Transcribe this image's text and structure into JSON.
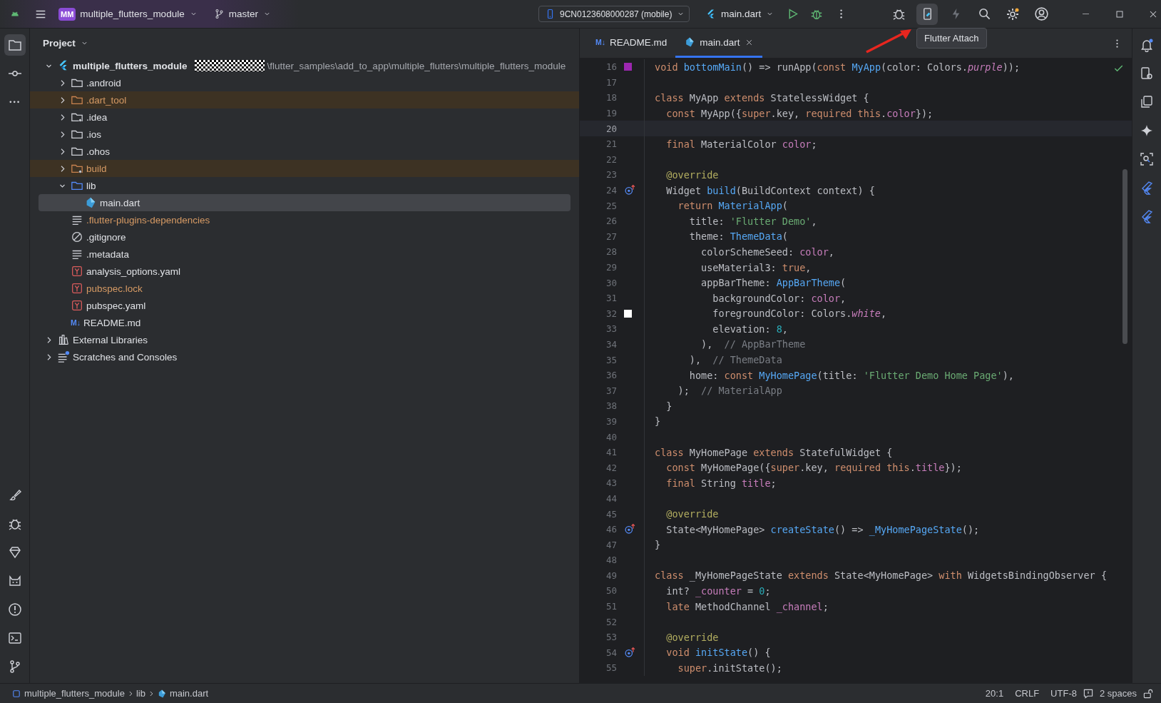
{
  "title_bar": {
    "project_badge": "MM",
    "project": "multiple_flutters_module",
    "branch": "master",
    "device": "9CN0123608000287 (mobile)",
    "run_config": "main.dart",
    "tooltip": "Flutter Attach"
  },
  "project_panel": {
    "title": "Project",
    "tree": [
      {
        "label": "multiple_flutters_module",
        "kind": "flutter",
        "expanded": true,
        "selected": false,
        "excluded": false,
        "ignored": false,
        "redacted": true,
        "path": "\\flutter_samples\\add_to_app\\multiple_flutters\\multiple_flutters_module",
        "children": [
          {
            "label": ".android",
            "kind": "folder",
            "expanded": false,
            "selected": false,
            "excluded": false,
            "ignored": false
          },
          {
            "label": ".dart_tool",
            "kind": "folder",
            "expanded": false,
            "selected": false,
            "excluded": true,
            "ignored": true
          },
          {
            "label": ".idea",
            "kind": "folder-config",
            "expanded": false,
            "selected": false,
            "excluded": false,
            "ignored": false
          },
          {
            "label": ".ios",
            "kind": "folder",
            "expanded": false,
            "selected": false,
            "excluded": false,
            "ignored": false
          },
          {
            "label": ".ohos",
            "kind": "folder",
            "expanded": false,
            "selected": false,
            "excluded": false,
            "ignored": false
          },
          {
            "label": "build",
            "kind": "folder-config",
            "expanded": false,
            "selected": false,
            "excluded": true,
            "ignored": true
          },
          {
            "label": "lib",
            "kind": "folder-source",
            "expanded": true,
            "selected": false,
            "excluded": false,
            "ignored": false,
            "children": [
              {
                "label": "main.dart",
                "kind": "dart",
                "selected": true,
                "excluded": false,
                "ignored": false
              }
            ]
          },
          {
            "label": ".flutter-plugins-dependencies",
            "kind": "text",
            "selected": false,
            "excluded": false,
            "ignored": true
          },
          {
            "label": ".gitignore",
            "kind": "ignore",
            "selected": false,
            "excluded": false,
            "ignored": false
          },
          {
            "label": ".metadata",
            "kind": "text",
            "selected": false,
            "excluded": false,
            "ignored": false
          },
          {
            "label": "analysis_options.yaml",
            "kind": "yaml",
            "selected": false,
            "excluded": false,
            "ignored": false
          },
          {
            "label": "pubspec.lock",
            "kind": "yaml",
            "selected": false,
            "excluded": false,
            "ignored": true
          },
          {
            "label": "pubspec.yaml",
            "kind": "yaml",
            "selected": false,
            "excluded": false,
            "ignored": false
          },
          {
            "label": "README.md",
            "kind": "markdown",
            "icon_text": "M↓",
            "selected": false,
            "excluded": false,
            "ignored": false
          }
        ]
      },
      {
        "label": "External Libraries",
        "kind": "library",
        "expanded": false,
        "selected": false,
        "excluded": false,
        "ignored": false
      },
      {
        "label": "Scratches and Consoles",
        "kind": "scratches",
        "expanded": false,
        "selected": false,
        "excluded": false,
        "ignored": false
      }
    ]
  },
  "editor": {
    "tabs": [
      {
        "label": "README.md",
        "kind": "markdown",
        "icon_text": "M↓",
        "selected": false
      },
      {
        "label": "main.dart",
        "kind": "dart",
        "selected": true
      }
    ],
    "lines": [
      {
        "number": "16",
        "current": false,
        "gutter": {
          "kind": "swatch",
          "color": "#9c27b0"
        },
        "tokens": [
          {
            "kind": "kw",
            "text": "void "
          },
          {
            "kind": "fn",
            "text": "bottomMain"
          },
          {
            "kind": "plain",
            "text": "() => runApp("
          },
          {
            "kind": "kw",
            "text": "const "
          },
          {
            "kind": "fn",
            "text": "MyApp"
          },
          {
            "kind": "plain",
            "text": "(color: Colors."
          },
          {
            "kind": "static",
            "text": "purple"
          },
          {
            "kind": "plain",
            "text": "));"
          }
        ]
      },
      {
        "number": "17",
        "current": false
      },
      {
        "number": "18",
        "current": false,
        "tokens": [
          {
            "kind": "kw",
            "text": "class"
          },
          {
            "kind": "plain",
            "text": " MyApp "
          },
          {
            "kind": "kw",
            "text": "extends"
          },
          {
            "kind": "plain",
            "text": " StatelessWidget {"
          }
        ]
      },
      {
        "number": "19",
        "current": false,
        "tokens": [
          {
            "kind": "kw",
            "text": "  const"
          },
          {
            "kind": "plain",
            "text": " MyApp({"
          },
          {
            "kind": "kw",
            "text": "super"
          },
          {
            "kind": "plain",
            "text": ".key, "
          },
          {
            "kind": "kw",
            "text": "required this"
          },
          {
            "kind": "plain",
            "text": "."
          },
          {
            "kind": "field",
            "text": "color"
          },
          {
            "kind": "plain",
            "text": "});"
          }
        ]
      },
      {
        "number": "20",
        "current": true
      },
      {
        "number": "21",
        "current": false,
        "tokens": [
          {
            "kind": "kw",
            "text": "  final"
          },
          {
            "kind": "plain",
            "text": " MaterialColor "
          },
          {
            "kind": "field",
            "text": "color"
          },
          {
            "kind": "plain",
            "text": ";"
          }
        ]
      },
      {
        "number": "22",
        "current": false
      },
      {
        "number": "23",
        "current": false,
        "tokens": [
          {
            "kind": "ann",
            "text": "  @override"
          }
        ]
      },
      {
        "number": "24",
        "current": false,
        "gutter": {
          "kind": "override"
        },
        "tokens": [
          {
            "kind": "plain",
            "text": "  Widget "
          },
          {
            "kind": "fn",
            "text": "build"
          },
          {
            "kind": "plain",
            "text": "(BuildContext context) {"
          }
        ]
      },
      {
        "number": "25",
        "current": false,
        "tokens": [
          {
            "kind": "kw",
            "text": "    return "
          },
          {
            "kind": "fn",
            "text": "MaterialApp"
          },
          {
            "kind": "plain",
            "text": "("
          }
        ]
      },
      {
        "number": "26",
        "current": false,
        "tokens": [
          {
            "kind": "plain",
            "text": "      title: "
          },
          {
            "kind": "str",
            "text": "'Flutter Demo'"
          },
          {
            "kind": "plain",
            "text": ","
          }
        ]
      },
      {
        "number": "27",
        "current": false,
        "tokens": [
          {
            "kind": "plain",
            "text": "      theme: "
          },
          {
            "kind": "fn",
            "text": "ThemeData"
          },
          {
            "kind": "plain",
            "text": "("
          }
        ]
      },
      {
        "number": "28",
        "current": false,
        "tokens": [
          {
            "kind": "plain",
            "text": "        colorSchemeSeed: "
          },
          {
            "kind": "field",
            "text": "color"
          },
          {
            "kind": "plain",
            "text": ","
          }
        ]
      },
      {
        "number": "29",
        "current": false,
        "tokens": [
          {
            "kind": "plain",
            "text": "        useMaterial3: "
          },
          {
            "kind": "kw",
            "text": "true"
          },
          {
            "kind": "plain",
            "text": ","
          }
        ]
      },
      {
        "number": "30",
        "current": false,
        "tokens": [
          {
            "kind": "plain",
            "text": "        appBarTheme: "
          },
          {
            "kind": "fn",
            "text": "AppBarTheme"
          },
          {
            "kind": "plain",
            "text": "("
          }
        ]
      },
      {
        "number": "31",
        "current": false,
        "tokens": [
          {
            "kind": "plain",
            "text": "          backgroundColor: "
          },
          {
            "kind": "field",
            "text": "color"
          },
          {
            "kind": "plain",
            "text": ","
          }
        ]
      },
      {
        "number": "32",
        "current": false,
        "gutter": {
          "kind": "swatch",
          "color": "#ffffff"
        },
        "tokens": [
          {
            "kind": "plain",
            "text": "          foregroundColor: Colors."
          },
          {
            "kind": "static",
            "text": "white"
          },
          {
            "kind": "plain",
            "text": ","
          }
        ]
      },
      {
        "number": "33",
        "current": false,
        "tokens": [
          {
            "kind": "plain",
            "text": "          elevation: "
          },
          {
            "kind": "num",
            "text": "8"
          },
          {
            "kind": "plain",
            "text": ","
          }
        ]
      },
      {
        "number": "34",
        "current": false,
        "tokens": [
          {
            "kind": "plain",
            "text": "        ),  "
          },
          {
            "kind": "comment",
            "text": "// AppBarTheme"
          }
        ]
      },
      {
        "number": "35",
        "current": false,
        "tokens": [
          {
            "kind": "plain",
            "text": "      ),  "
          },
          {
            "kind": "comment",
            "text": "// ThemeData"
          }
        ]
      },
      {
        "number": "36",
        "current": false,
        "tokens": [
          {
            "kind": "plain",
            "text": "      home: "
          },
          {
            "kind": "kw",
            "text": "const "
          },
          {
            "kind": "fn",
            "text": "MyHomePage"
          },
          {
            "kind": "plain",
            "text": "(title: "
          },
          {
            "kind": "str",
            "text": "'Flutter Demo Home Page'"
          },
          {
            "kind": "plain",
            "text": "),"
          }
        ]
      },
      {
        "number": "37",
        "current": false,
        "tokens": [
          {
            "kind": "plain",
            "text": "    );  "
          },
          {
            "kind": "comment",
            "text": "// MaterialApp"
          }
        ]
      },
      {
        "number": "38",
        "current": false,
        "tokens": [
          {
            "kind": "plain",
            "text": "  }"
          }
        ]
      },
      {
        "number": "39",
        "current": false,
        "tokens": [
          {
            "kind": "plain",
            "text": "}"
          }
        ]
      },
      {
        "number": "40",
        "current": false
      },
      {
        "number": "41",
        "current": false,
        "tokens": [
          {
            "kind": "kw",
            "text": "class"
          },
          {
            "kind": "plain",
            "text": " MyHomePage "
          },
          {
            "kind": "kw",
            "text": "extends"
          },
          {
            "kind": "plain",
            "text": " StatefulWidget {"
          }
        ]
      },
      {
        "number": "42",
        "current": false,
        "tokens": [
          {
            "kind": "kw",
            "text": "  const"
          },
          {
            "kind": "plain",
            "text": " MyHomePage({"
          },
          {
            "kind": "kw",
            "text": "super"
          },
          {
            "kind": "plain",
            "text": ".key, "
          },
          {
            "kind": "kw",
            "text": "required this"
          },
          {
            "kind": "plain",
            "text": "."
          },
          {
            "kind": "field",
            "text": "title"
          },
          {
            "kind": "plain",
            "text": "});"
          }
        ]
      },
      {
        "number": "43",
        "current": false,
        "tokens": [
          {
            "kind": "kw",
            "text": "  final"
          },
          {
            "kind": "plain",
            "text": " String "
          },
          {
            "kind": "field",
            "text": "title"
          },
          {
            "kind": "plain",
            "text": ";"
          }
        ]
      },
      {
        "number": "44",
        "current": false
      },
      {
        "number": "45",
        "current": false,
        "tokens": [
          {
            "kind": "ann",
            "text": "  @override"
          }
        ]
      },
      {
        "number": "46",
        "current": false,
        "gutter": {
          "kind": "override"
        },
        "tokens": [
          {
            "kind": "plain",
            "text": "  State<MyHomePage> "
          },
          {
            "kind": "fn",
            "text": "createState"
          },
          {
            "kind": "plain",
            "text": "() => "
          },
          {
            "kind": "fn",
            "text": "_MyHomePageState"
          },
          {
            "kind": "plain",
            "text": "();"
          }
        ]
      },
      {
        "number": "47",
        "current": false,
        "tokens": [
          {
            "kind": "plain",
            "text": "}"
          }
        ]
      },
      {
        "number": "48",
        "current": false
      },
      {
        "number": "49",
        "current": false,
        "tokens": [
          {
            "kind": "kw",
            "text": "class"
          },
          {
            "kind": "plain",
            "text": " _MyHomePageState "
          },
          {
            "kind": "kw",
            "text": "extends"
          },
          {
            "kind": "plain",
            "text": " State<MyHomePage> "
          },
          {
            "kind": "kw",
            "text": "with"
          },
          {
            "kind": "plain",
            "text": " WidgetsBindingObserver {"
          }
        ]
      },
      {
        "number": "50",
        "current": false,
        "tokens": [
          {
            "kind": "plain",
            "text": "  int? "
          },
          {
            "kind": "field",
            "text": "_counter"
          },
          {
            "kind": "plain",
            "text": " = "
          },
          {
            "kind": "num",
            "text": "0"
          },
          {
            "kind": "plain",
            "text": ";"
          }
        ]
      },
      {
        "number": "51",
        "current": false,
        "tokens": [
          {
            "kind": "kw",
            "text": "  late"
          },
          {
            "kind": "plain",
            "text": " MethodChannel "
          },
          {
            "kind": "field",
            "text": "_channel"
          },
          {
            "kind": "plain",
            "text": ";"
          }
        ]
      },
      {
        "number": "52",
        "current": false
      },
      {
        "number": "53",
        "current": false,
        "tokens": [
          {
            "kind": "ann",
            "text": "  @override"
          }
        ]
      },
      {
        "number": "54",
        "current": false,
        "gutter": {
          "kind": "override"
        },
        "tokens": [
          {
            "kind": "kw",
            "text": "  void "
          },
          {
            "kind": "fn",
            "text": "initState"
          },
          {
            "kind": "plain",
            "text": "() {"
          }
        ]
      },
      {
        "number": "55",
        "current": false,
        "tokens": [
          {
            "kind": "kw",
            "text": "    super"
          },
          {
            "kind": "plain",
            "text": ".initState();"
          }
        ]
      }
    ]
  },
  "status_bar": {
    "breadcrumbs": [
      {
        "label": "multiple_flutters_module",
        "kind": "module"
      },
      {
        "label": "lib"
      },
      {
        "label": "main.dart",
        "kind": "dart"
      }
    ],
    "caret_position": "20:1",
    "line_separator": "CRLF",
    "encoding": "UTF-8",
    "indent": "2 spaces"
  }
}
